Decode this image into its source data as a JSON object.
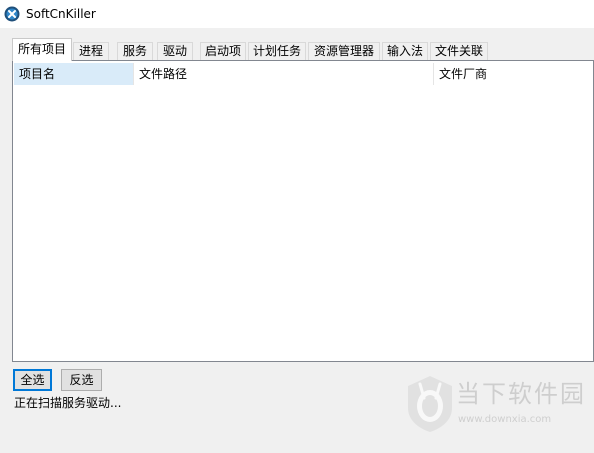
{
  "window": {
    "title": "SoftCnKiller",
    "icon": "softcnkiller-app-icon"
  },
  "tabs": [
    {
      "label": "所有项目",
      "active": true
    },
    {
      "label": "进程",
      "active": false
    },
    {
      "label": "服务",
      "active": false
    },
    {
      "label": "驱动",
      "active": false
    },
    {
      "label": "启动项",
      "active": false
    },
    {
      "label": "计划任务",
      "active": false
    },
    {
      "label": "资源管理器",
      "active": false
    },
    {
      "label": "输入法",
      "active": false
    },
    {
      "label": "文件关联",
      "active": false
    }
  ],
  "list": {
    "columns": [
      "项目名",
      "文件路径",
      "文件厂商"
    ],
    "rows": []
  },
  "buttons": {
    "select_all": "全选",
    "invert_selection": "反选"
  },
  "status": "正在扫描服务驱动...",
  "watermark": {
    "text": "当下软件园",
    "url": "www.downxia.com"
  },
  "colors": {
    "selected_header": "#d9ebf9",
    "focus_border": "#0078d7",
    "panel_border": "#828790"
  }
}
